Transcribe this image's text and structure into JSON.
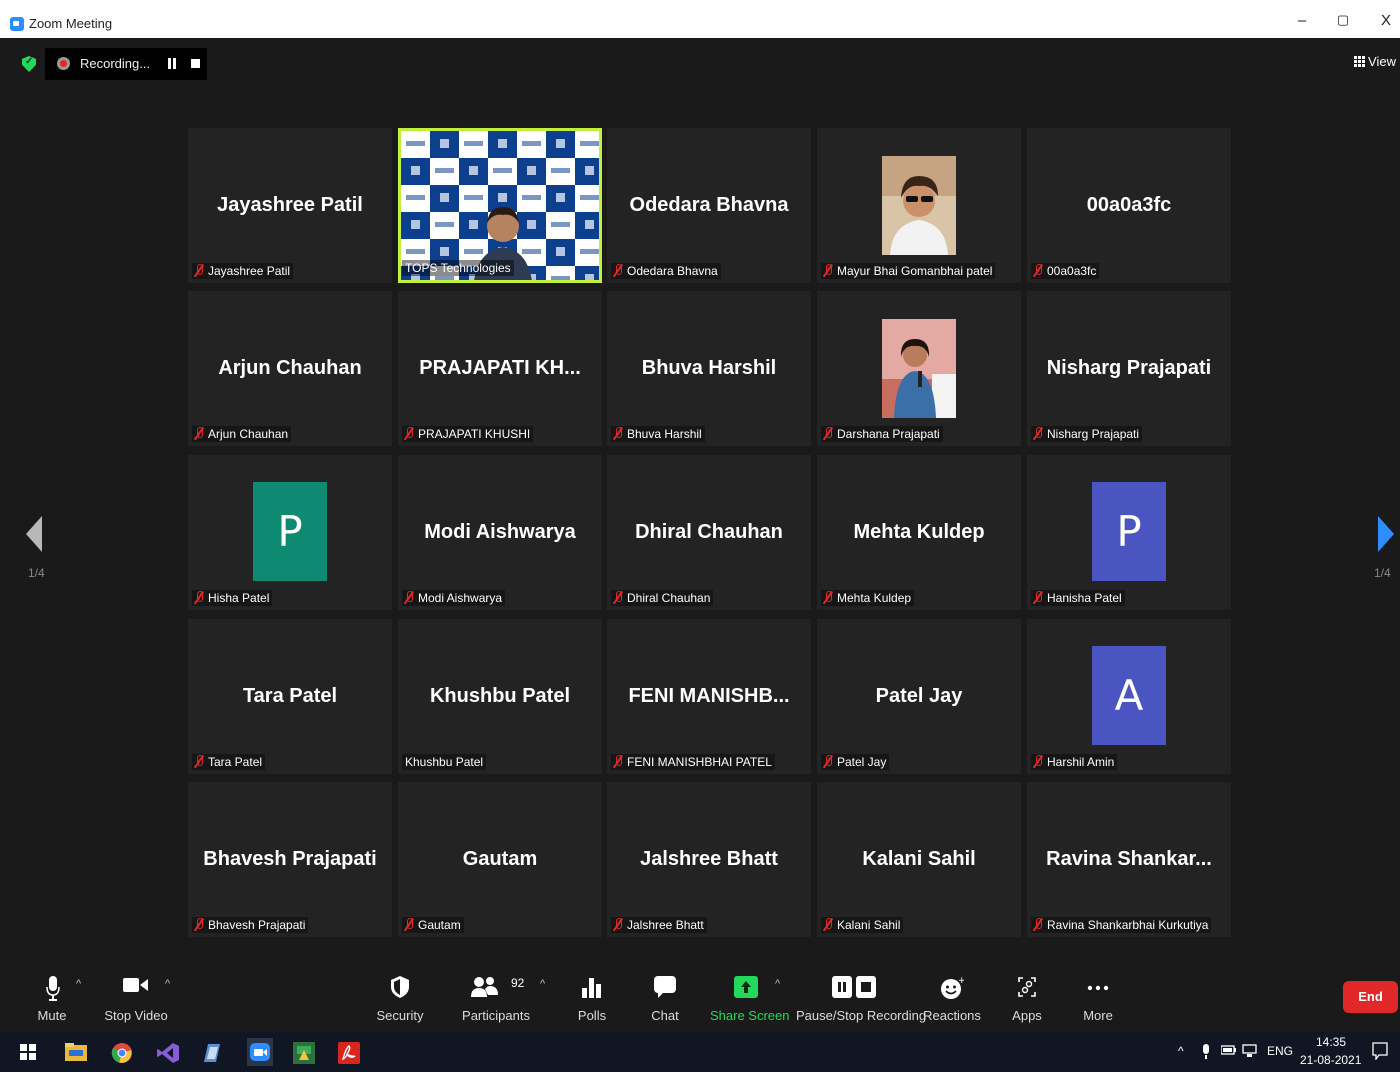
{
  "window": {
    "title": "Zoom Meeting",
    "minimize": "–",
    "maximize": "▢",
    "close": "X"
  },
  "topbar": {
    "recording_text": "Recording...",
    "view_label": "View"
  },
  "pagination": {
    "left": "1/4",
    "right": "1/4"
  },
  "tiles": [
    {
      "big": "Jayashree Patil",
      "label": "Jayashree Patil",
      "muted": true
    },
    {
      "big": "",
      "label": "TOPS Technologies",
      "muted": false,
      "active": true
    },
    {
      "big": "Odedara Bhavna",
      "label": "Odedara Bhavna",
      "muted": true
    },
    {
      "big": "",
      "label": "Mayur Bhai Gomanbhai patel",
      "muted": true,
      "photo": "man"
    },
    {
      "big": "00a0a3fc",
      "label": "00a0a3fc",
      "muted": true
    },
    {
      "big": "Arjun Chauhan",
      "label": "Arjun Chauhan",
      "muted": true
    },
    {
      "big": "PRAJAPATI  KH...",
      "label": "PRAJAPATI KHUSHI",
      "muted": true
    },
    {
      "big": "Bhuva Harshil",
      "label": "Bhuva Harshil",
      "muted": true
    },
    {
      "big": "",
      "label": "Darshana Prajapati",
      "muted": true,
      "photo": "woman"
    },
    {
      "big": "Nisharg Prajapati",
      "label": "Nisharg Prajapati",
      "muted": true
    },
    {
      "big": "",
      "label": "Hisha Patel",
      "muted": true,
      "avatar": "P",
      "avatar_color": "#0f8a72"
    },
    {
      "big": "Modi Aishwarya",
      "label": "Modi Aishwarya",
      "muted": true
    },
    {
      "big": "Dhiral Chauhan",
      "label": "Dhiral Chauhan",
      "muted": true
    },
    {
      "big": "Mehta Kuldep",
      "label": "Mehta Kuldep",
      "muted": true
    },
    {
      "big": "",
      "label": "Hanisha Patel",
      "muted": true,
      "avatar": "P",
      "avatar_color": "#4a55c2"
    },
    {
      "big": "Tara Patel",
      "label": "Tara Patel",
      "muted": true
    },
    {
      "big": "Khushbu Patel",
      "label": "Khushbu Patel",
      "muted": false
    },
    {
      "big": "FENI  MANISHB...",
      "label": "FENI MANISHBHAI PATEL",
      "muted": true
    },
    {
      "big": "Patel Jay",
      "label": "Patel Jay",
      "muted": true
    },
    {
      "big": "",
      "label": "Harshil Amin",
      "muted": true,
      "avatar": "A",
      "avatar_color": "#4a55c2"
    },
    {
      "big": "Bhavesh Prajapati",
      "label": "Bhavesh Prajapati",
      "muted": true
    },
    {
      "big": "Gautam",
      "label": "Gautam",
      "muted": true
    },
    {
      "big": "Jalshree Bhatt",
      "label": "Jalshree Bhatt",
      "muted": true
    },
    {
      "big": "Kalani Sahil",
      "label": "Kalani Sahil",
      "muted": true
    },
    {
      "big": "Ravina  Shankar...",
      "label": "Ravina Shankarbhai Kurkutiya",
      "muted": true
    }
  ],
  "toolbar": {
    "mute": "Mute",
    "stop_video": "Stop Video",
    "security": "Security",
    "participants": "Participants",
    "participants_count": "92",
    "polls": "Polls",
    "chat": "Chat",
    "share_screen": "Share Screen",
    "pause_stop_recording": "Pause/Stop Recording",
    "reactions": "Reactions",
    "apps": "Apps",
    "more": "More",
    "end": "End"
  },
  "taskbar": {
    "lang": "ENG",
    "time": "14:35",
    "date": "21-08-2021"
  },
  "colors": {
    "accent": "#2d8cff",
    "share_green": "#23d959",
    "end_red": "#e02828",
    "active_border": "#c3f03c"
  }
}
